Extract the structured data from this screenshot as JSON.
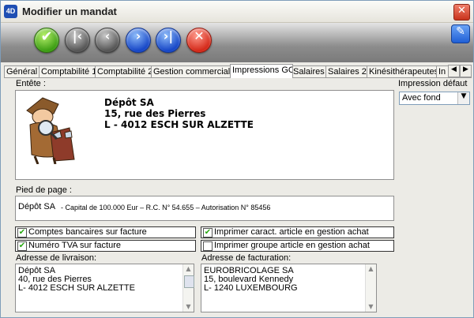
{
  "window": {
    "title": "Modifier un mandat",
    "app_icon": "4D"
  },
  "toolbar": {
    "buttons": [
      {
        "name": "validate",
        "glyph": "✔",
        "color": "#3d9e14"
      },
      {
        "name": "first",
        "glyph": "|‹",
        "color": "#565656"
      },
      {
        "name": "previous",
        "glyph": "‹",
        "color": "#565656"
      },
      {
        "name": "next",
        "glyph": "›",
        "color": "#1747c7"
      },
      {
        "name": "last",
        "glyph": "›|",
        "color": "#1747c7"
      },
      {
        "name": "cancel",
        "glyph": "✕",
        "color": "#d42a1a"
      }
    ],
    "wand_icon": "magic-wand-icon"
  },
  "tabs": [
    {
      "label": "Général"
    },
    {
      "label": "Comptabilité 1"
    },
    {
      "label": "Comptabilité 2"
    },
    {
      "label": "Gestion commerciale"
    },
    {
      "label": "Impressions GC",
      "active": true
    },
    {
      "label": "Salaires"
    },
    {
      "label": "Salaires 2"
    },
    {
      "label": "Kinésithérapeutes"
    },
    {
      "label": "In"
    }
  ],
  "entete": {
    "label": "Entête :",
    "line1": "Dépôt SA",
    "line2": "15, rue des Pierres",
    "line3": "L - 4012 ESCH SUR ALZETTE"
  },
  "impression_defaut": {
    "label": "Impression défaut",
    "value": "Avec fond"
  },
  "pied_de_page": {
    "label": "Pied de page :",
    "company": "Dépôt SA",
    "details": "- Capital de 100.000 Eur – R.C. N° 54.655 – Autorisation N° 85456"
  },
  "checkboxes": {
    "comptes_bancaires": {
      "label": "Comptes bancaires sur facture",
      "checked": true
    },
    "numero_tva": {
      "label": "Numéro TVA sur facture",
      "checked": true
    },
    "imprimer_caract": {
      "label": "Imprimer caract. article en gestion achat",
      "checked": true
    },
    "imprimer_groupe": {
      "label": "Imprimer groupe article en gestion achat",
      "checked": false
    }
  },
  "livraison": {
    "label": "Adresse de livraison:",
    "line1": "Dépôt SA",
    "line2": "40, rue des Pierres",
    "line3": "L- 4012 ESCH SUR ALZETTE"
  },
  "facturation": {
    "label": "Adresse de facturation:",
    "line1": "EUROBRICOLAGE SA",
    "line2": "15, boulevard Kennedy",
    "line3": "L- 1240 LUXEMBOURG"
  }
}
